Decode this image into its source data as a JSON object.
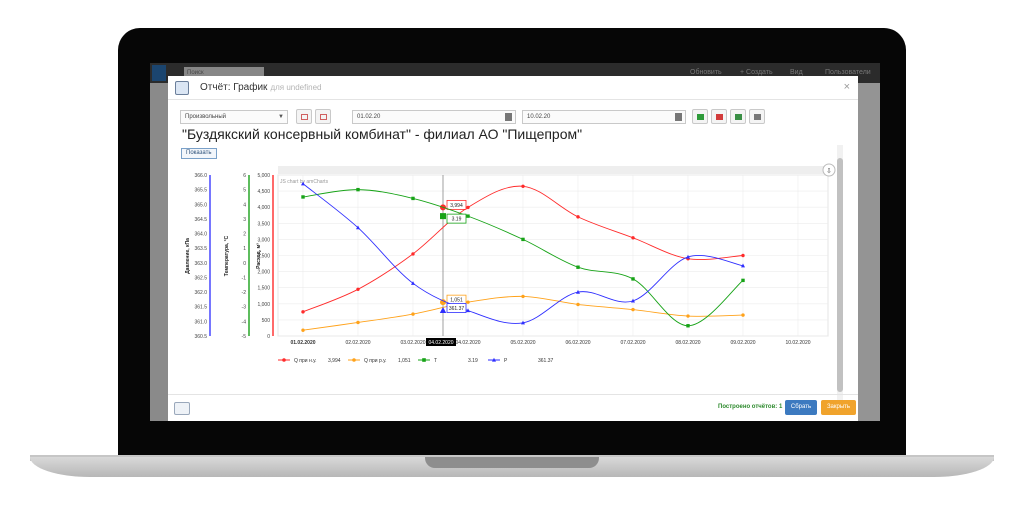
{
  "app": {
    "search_placeholder": "Поиск",
    "links": [
      "Обновить",
      "+ Создать",
      "Вид",
      "Пользователи"
    ]
  },
  "modal": {
    "title": "Отчёт: График",
    "title_suffix": "для undefined",
    "close": "×"
  },
  "toolbar": {
    "period": "Произвольный",
    "date_from": "01.02.20",
    "date_to": "10.02.20"
  },
  "report": {
    "title": "\"Буздякский консервный комбинат\" - филиал АО \"Пищепром\"",
    "show_button": "Показать"
  },
  "chart_data": {
    "type": "line",
    "credit": "JS chart by amCharts",
    "x": [
      "01.02.2020",
      "02.02.2020",
      "03.02.2020",
      "04.02.2020",
      "05.02.2020",
      "06.02.2020",
      "07.02.2020",
      "08.02.2020",
      "09.02.2020",
      "10.02.2020"
    ],
    "cursor_x": "04.02.2020",
    "axes": [
      {
        "label": "Давление, кПа",
        "color": "#3b3bff",
        "ylim": [
          360.5,
          366.0
        ],
        "ticks": [
          "366.0",
          "365.5",
          "365.0",
          "364.5",
          "364.0",
          "363.5",
          "363.0",
          "362.5",
          "362.0",
          "361.5",
          "361.0",
          "360.5"
        ]
      },
      {
        "label": "Температура, °С",
        "color": "#1aa11a",
        "ylim": [
          -5,
          6
        ],
        "ticks": [
          "6",
          "5",
          "4",
          "3",
          "2",
          "1",
          "0",
          "-1",
          "-2",
          "-3",
          "-4",
          "-5"
        ]
      },
      {
        "label": "Расход, м³",
        "color": "#ff2a2a",
        "ylim": [
          0,
          5000
        ],
        "ticks": [
          "5,000",
          "4,500",
          "4,000",
          "3,500",
          "3,000",
          "2,500",
          "2,000",
          "1,500",
          "1,000",
          "500",
          "0"
        ]
      }
    ],
    "series": [
      {
        "name": "Q при н.у.",
        "legend_value": "3,994",
        "color": "#ff2b2b",
        "marker": "circle",
        "axis": 2,
        "values": [
          750,
          1450,
          2550,
          3994,
          4650,
          3700,
          3050,
          2400,
          2500,
          null
        ]
      },
      {
        "name": "Q при р.у.",
        "legend_value": "1,051",
        "color": "#ffa21a",
        "marker": "circle",
        "axis": 2,
        "values": [
          180,
          420,
          680,
          1051,
          1230,
          980,
          820,
          620,
          650,
          null
        ]
      },
      {
        "name": "T",
        "legend_value": "3.19",
        "color": "#17a317",
        "marker": "square",
        "axis": 1,
        "values": [
          4.5,
          5.0,
          4.4,
          3.19,
          1.6,
          -0.3,
          -1.1,
          -4.3,
          -1.2,
          null
        ]
      },
      {
        "name": "P",
        "legend_value": "361.37",
        "color": "#2e2eff",
        "marker": "triangle",
        "axis": 0,
        "values": [
          365.7,
          364.2,
          362.3,
          361.37,
          360.95,
          362.0,
          361.7,
          363.2,
          362.9,
          null
        ]
      }
    ]
  },
  "footer": {
    "built_label": "Построено отчётов:",
    "built_count": "1",
    "refresh_button": "Сбрать",
    "close_button": "Закрыть"
  }
}
